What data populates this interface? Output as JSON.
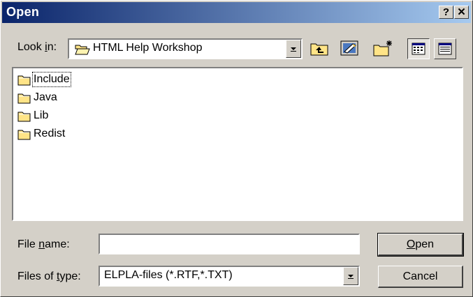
{
  "window": {
    "title": "Open",
    "help_glyph": "?",
    "close_glyph": "✕"
  },
  "lookin": {
    "label_pre": "Look ",
    "label_key": "i",
    "label_post": "n:",
    "value": "HTML Help Workshop",
    "icon": "open-folder-icon"
  },
  "toolbar": {
    "icons": [
      "up-folder-icon",
      "desktop-icon",
      "new-folder-icon",
      "list-view-icon",
      "details-view-icon"
    ]
  },
  "files": [
    {
      "name": "Include",
      "icon": "folder-icon"
    },
    {
      "name": "Java",
      "icon": "folder-icon"
    },
    {
      "name": "Lib",
      "icon": "folder-icon"
    },
    {
      "name": "Redist",
      "icon": "folder-icon"
    }
  ],
  "filename": {
    "label_pre": "File ",
    "label_key": "n",
    "label_post": "ame:",
    "value": ""
  },
  "filetype": {
    "label_pre": "Files of ",
    "label_key": "t",
    "label_post": "ype:",
    "value": "ELPLA-files (*.RTF,*.TXT)"
  },
  "buttons": {
    "open_key": "O",
    "open_rest": "pen",
    "cancel": "Cancel"
  },
  "colors": {
    "title_start": "#0a246a",
    "title_end": "#a6caf0",
    "face": "#d4d0c8",
    "folder": "#ffe487"
  }
}
